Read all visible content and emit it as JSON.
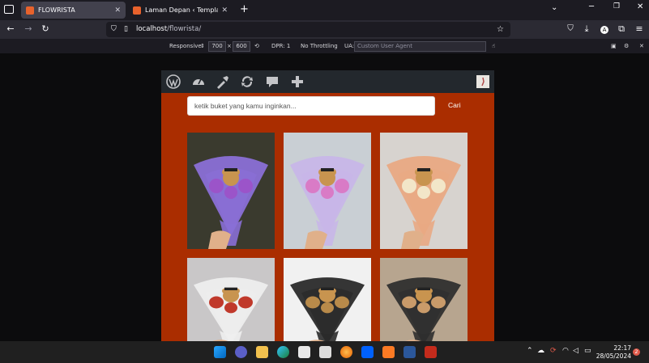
{
  "browser": {
    "tabs": [
      {
        "title": "FLOWRISTA",
        "active": true
      },
      {
        "title": "Laman Depan ‹ Templat ‹ FLOWRI",
        "active": false
      }
    ],
    "new_tab_label": "+",
    "url_host": "localhost",
    "url_path": "/flowrista/"
  },
  "rdm": {
    "device": "Responsive",
    "width": "700",
    "height": "600",
    "dpr": "DPR: 1",
    "throttling": "No Throttling",
    "ua_label": "UA:",
    "ua_placeholder": "Custom User Agent"
  },
  "page": {
    "search_placeholder": "ketik buket yang kamu inginkan...",
    "search_button": "Cari",
    "products": [
      {
        "wrap": "#8a6fd6",
        "flowers": "#9b54c9",
        "bg": "#3a3a2e"
      },
      {
        "wrap": "#c8b6e8",
        "flowers": "#d97bc6",
        "bg": "#c9cfd4"
      },
      {
        "wrap": "#e9a983",
        "flowers": "#f2e6c8",
        "bg": "#d7d3cf"
      },
      {
        "wrap": "#eeeeee",
        "flowers": "#c0392b",
        "bg": "#c9c7c8"
      },
      {
        "wrap": "#2a2a2a",
        "flowers": "#b88a4a",
        "bg": "#f1f1f1"
      },
      {
        "wrap": "#2f2f2f",
        "flowers": "#c99b6a",
        "bg": "#b7a58f"
      }
    ]
  },
  "taskbar": {
    "time": "22:17",
    "date": "28/05/2024",
    "notification_count": "2"
  },
  "colors": {
    "page_bg": "#aa2d00",
    "wp_bar": "#23282d",
    "accent": "#e8622c"
  }
}
